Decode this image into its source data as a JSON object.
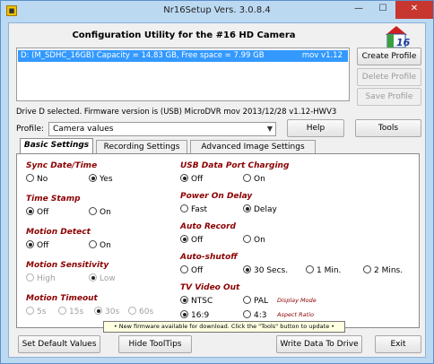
{
  "window": {
    "title": "Nr16Setup  Vers. 3.0.8.4",
    "minimize_glyph": "—",
    "maximize_glyph": "☐",
    "close_glyph": "✕",
    "app_icon": "app-icon"
  },
  "header": {
    "title": "Configuration Utility for the #16 HD Camera",
    "logo_text": "16"
  },
  "drive_list": {
    "items": [
      {
        "text": "D: (M_SDHC_16GB) Capacity = 14.83 GB, Free space = 7.99 GB",
        "version": "mov v1.12"
      }
    ]
  },
  "profile_buttons": {
    "create": "Create Profile",
    "delete": "Delete Profile",
    "save": "Save Profile"
  },
  "status_text": "Drive D selected. Firmware version is (USB) MicroDVR mov 2013/12/28 v1.12-HWV3",
  "profile": {
    "label": "Profile:",
    "selected": "Camera values",
    "help": "Help",
    "tools": "Tools"
  },
  "tabs": [
    "Basic Settings",
    "Recording Settings",
    "Advanced Image Settings"
  ],
  "left_sections": [
    {
      "title": "Sync Date/Time",
      "options": [
        {
          "label": "No",
          "checked": false
        },
        {
          "label": "Yes",
          "checked": true
        }
      ]
    },
    {
      "title": "Time Stamp",
      "options": [
        {
          "label": "Off",
          "checked": true
        },
        {
          "label": "On",
          "checked": false
        }
      ]
    },
    {
      "title": "Motion Detect",
      "options": [
        {
          "label": "Off",
          "checked": true
        },
        {
          "label": "On",
          "checked": false
        }
      ]
    },
    {
      "title": "Motion Sensitivity",
      "options": [
        {
          "label": "High",
          "checked": false
        },
        {
          "label": "Low",
          "checked": true
        }
      ]
    },
    {
      "title": "Motion Timeout",
      "options": [
        {
          "label": "5s",
          "checked": false
        },
        {
          "label": "15s",
          "checked": false
        },
        {
          "label": "30s",
          "checked": true
        },
        {
          "label": "60s",
          "checked": false
        }
      ]
    }
  ],
  "right_sections": [
    {
      "title": "USB Data Port Charging",
      "options": [
        {
          "label": "Off",
          "checked": true
        },
        {
          "label": "On",
          "checked": false
        }
      ]
    },
    {
      "title": "Power On Delay",
      "options": [
        {
          "label": "Fast",
          "checked": false
        },
        {
          "label": "Delay",
          "checked": true
        }
      ]
    },
    {
      "title": "Auto Record",
      "options": [
        {
          "label": "Off",
          "checked": true
        },
        {
          "label": "On",
          "checked": false
        }
      ]
    },
    {
      "title": "Auto-shutoff",
      "options": [
        {
          "label": "Off",
          "checked": false
        },
        {
          "label": "30 Secs.",
          "checked": true
        },
        {
          "label": "1 Min.",
          "checked": false
        },
        {
          "label": "2 Mins.",
          "checked": false
        }
      ]
    },
    {
      "title": "TV Video Out",
      "options": [
        {
          "label": "NTSC",
          "checked": true
        },
        {
          "label": "PAL",
          "checked": false
        },
        {
          "label": "16:9",
          "checked": true
        },
        {
          "label": "4:3",
          "checked": false
        }
      ],
      "notes": [
        "Display Mode",
        "Aspect Ratio"
      ]
    }
  ],
  "tooltip": "• New firmware available for download. Click the \"Tools\" button to update •",
  "footer": {
    "defaults": "Set Default Values",
    "hide_tips": "Hide ToolTips",
    "write": "Write Data To Drive",
    "exit": "Exit"
  }
}
